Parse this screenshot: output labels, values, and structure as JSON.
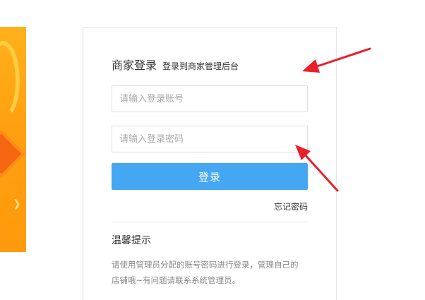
{
  "login": {
    "title": "商家登录",
    "subtitle": "登录到商家管理后台",
    "account_placeholder": "请输入登录账号",
    "password_placeholder": "请输入登录密码",
    "login_button": "登录",
    "forgot_password": "忘记密码"
  },
  "tips": {
    "title": "温馨提示",
    "line1": "请使用管理员分配的账号密码进行登录，管理自己的",
    "line2": "店铺哦~有问题请联系系统管理员。"
  },
  "colors": {
    "primary_button": "#45a6f2",
    "annotation_arrow": "#e8202a",
    "banner": "#ffa010"
  },
  "icons": {
    "banner_chevron": "chevron-right-icon"
  }
}
